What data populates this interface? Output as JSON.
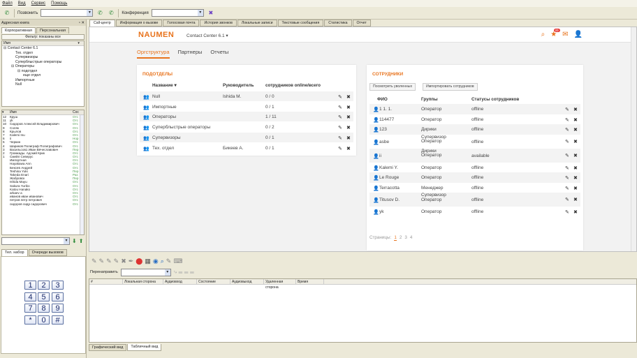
{
  "menu": [
    "Файл",
    "Вид",
    "Сервис",
    "Помощь"
  ],
  "toolbar": {
    "call_label": "Позвонить",
    "conference_label": "Конференция"
  },
  "left": {
    "panel_title": "Адресная книга",
    "tabs": [
      "Корпоративная",
      "Персональная"
    ],
    "filter_label": "Фильтр: показаны все",
    "tree_header": "Имя",
    "tree": [
      "⊟ Contact Center 6.1",
      "Тех. отдел",
      "Супервизоры",
      "Суперблыстрые операторы",
      "⊟ Операторы",
      "⊟ подотдел",
      "еще отдел",
      "Импортные",
      "Null"
    ],
    "contacts_header": {
      "name": "Имя",
      "status": "Сос"
    },
    "contacts": [
      {
        "n": "12",
        "name": "Круш",
        "st": "Отс"
      },
      {
        "n": "11",
        "name": "yk",
        "st": "Отс"
      },
      {
        "n": "10",
        "name": "Сидоров Алексей Владимирович",
        "st": "Отс"
      },
      {
        "n": "9",
        "name": "Соляк",
        "st": "Отс"
      },
      {
        "n": "8",
        "name": "Крылов",
        "st": "Отс"
      },
      {
        "n": "7",
        "name": "Kalemi Inu",
        "st": "Отс"
      },
      {
        "n": "6",
        "name": "ii",
        "st": "Нор"
      },
      {
        "n": "5",
        "name": "Черкин",
        "st": "Отс"
      },
      {
        "n": "4",
        "name": "Шариков Полиграф Полиграфович",
        "st": "Отс"
      },
      {
        "n": "3",
        "name": "Васильсов1 Иван Вячеславович",
        "st": "Пер"
      },
      {
        "n": "2",
        "name": "Громкады. Адский Крик",
        "st": "Отс"
      },
      {
        "n": "1",
        "name": "Смейл Северус",
        "st": "Отс"
      },
      {
        "n": "",
        "name": "Импортная",
        "st": "Отс"
      },
      {
        "n": "",
        "name": "Hayakawa Ann",
        "st": "Отс"
      },
      {
        "n": "",
        "name": "Бексев Андрей",
        "st": "Отс"
      },
      {
        "n": "",
        "name": "Teshina Yuki",
        "st": "Пер"
      },
      {
        "n": "",
        "name": "Takeda Enari",
        "st": "Раз"
      },
      {
        "n": "",
        "name": "Жабровск",
        "st": "Пер"
      },
      {
        "n": "",
        "name": "Ishida Mayu",
        "st": "Отс"
      },
      {
        "n": "",
        "name": "Sakura Yuriko",
        "st": "Отс"
      },
      {
        "n": "",
        "name": "Katou Hanako",
        "st": "Отс"
      },
      {
        "n": "",
        "name": "arkaev a",
        "st": "Отс"
      },
      {
        "n": "",
        "name": "иванов иван иванович",
        "st": "Отс"
      },
      {
        "n": "",
        "name": "петров петр петрович",
        "st": "Отс"
      },
      {
        "n": "",
        "name": "сидоров сидр сидорович",
        "st": "Отс"
      }
    ],
    "bottom_tabs": [
      "Тел. набор",
      "Очереди вызовов"
    ],
    "keys": [
      "1",
      "2",
      "3",
      "4",
      "5",
      "6",
      "7",
      "8",
      "9",
      "*",
      "0",
      "#"
    ]
  },
  "main_tabs": [
    "Call-центр",
    "Информация о вызове",
    "Голосовая почта",
    "История звонков",
    "Локальные записи",
    "Текстовые сообщения",
    "Статистика",
    "Отчет"
  ],
  "web": {
    "logo": "NAUMEN",
    "product": "Contact Center 6.1",
    "badge": "20",
    "nav": [
      "Оргструктура",
      "Партнеры",
      "Отчеты"
    ],
    "subdivisions": {
      "title": "ПОДОТДЕЛЫ",
      "headers": [
        "Название ▾",
        "Руководитель",
        "сотрудников online/всего"
      ],
      "rows": [
        {
          "name": "Null",
          "head": "Ishida M.",
          "count": "0 / 0"
        },
        {
          "name": "Импортные",
          "head": "",
          "count": "0 / 1"
        },
        {
          "name": "Операторы",
          "head": "",
          "count": "1 / 11"
        },
        {
          "name": "Суперблыстрые операторы",
          "head": "",
          "count": "0 / 2"
        },
        {
          "name": "Супервизоры",
          "head": "",
          "count": "0 / 1"
        },
        {
          "name": "Тех. отдел",
          "head": "Бикеев А.",
          "count": "0 / 1"
        }
      ]
    },
    "employees": {
      "title": "СОТРУДНИКИ",
      "btn_fired": "Посмотреть уволенных",
      "btn_import": "Импортировать сотрудников",
      "headers": [
        "ФИО",
        "Группы",
        "Статусы сотрудников"
      ],
      "rows": [
        {
          "name": "1 1. 1.",
          "group": "Оператор",
          "status": "offline"
        },
        {
          "name": "114477",
          "group": "Оператор",
          "status": "offline"
        },
        {
          "name": "123",
          "group": "Дирики",
          "status": "offline"
        },
        {
          "name": "asbe",
          "group": "Супервизор Оператор",
          "status": "offline"
        },
        {
          "name": "ii",
          "group": "Дирики Оператор",
          "status": "available"
        },
        {
          "name": "Kalemi Y.",
          "group": "Оператор",
          "status": "offline"
        },
        {
          "name": "Le Rouge",
          "group": "Оператор",
          "status": "offline"
        },
        {
          "name": "Terracotta",
          "group": "Менеджер",
          "status": "offline"
        },
        {
          "name": "Titusov D.",
          "group": "Супервизор Оператор",
          "status": "offline"
        },
        {
          "name": "yk",
          "group": "Оператор",
          "status": "offline"
        }
      ],
      "pages_label": "Страницы:",
      "pages": [
        "1",
        "2",
        "3",
        "4"
      ]
    }
  },
  "calls": {
    "redirect_label": "Перенаправить",
    "columns": [
      "#",
      "Локальная сторона",
      "Аудиовход",
      "Состояние",
      "Аудиовыход",
      "Удаленная сторона",
      "Время"
    ]
  },
  "view_tabs": [
    "Графический вид",
    "Табличный вид"
  ]
}
